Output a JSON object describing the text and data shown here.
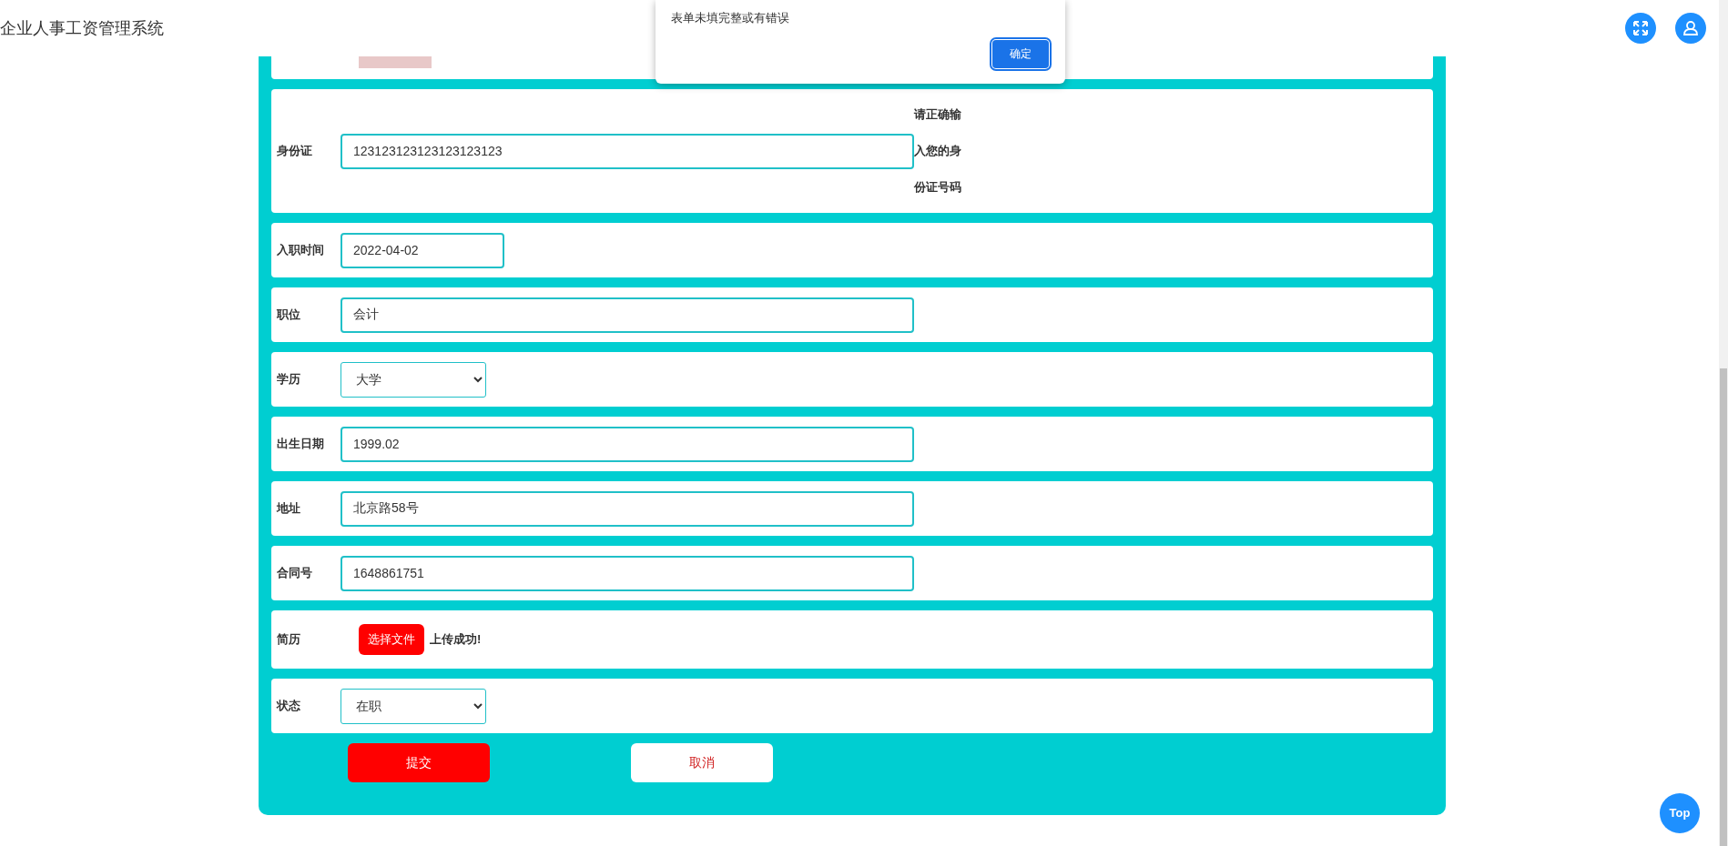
{
  "header": {
    "title": "企业人事工资管理系统"
  },
  "dialog": {
    "message": "表单未填完整或有错误",
    "ok_button": "确定"
  },
  "form": {
    "rows": [
      {
        "kind": "photo"
      },
      {
        "kind": "input",
        "label": "身份证",
        "value": "123123123123123123123",
        "hint": [
          "请正确输",
          "入您的身",
          "份证号码"
        ]
      },
      {
        "kind": "date",
        "label": "入职时间",
        "value": "2022-04-02"
      },
      {
        "kind": "input",
        "label": "职位",
        "value": "会计"
      },
      {
        "kind": "select",
        "label": "学历",
        "value": "大学"
      },
      {
        "kind": "input",
        "label": "出生日期",
        "value": "1999.02"
      },
      {
        "kind": "input",
        "label": "地址",
        "value": "北京路58号"
      },
      {
        "kind": "input",
        "label": "合同号",
        "value": "1648861751"
      },
      {
        "kind": "file",
        "label": "简历",
        "button": "选择文件",
        "status": "上传成功!"
      },
      {
        "kind": "select",
        "label": "状态",
        "value": "在职"
      }
    ],
    "submit": "提交",
    "cancel": "取消"
  },
  "back_to_top": "Top"
}
